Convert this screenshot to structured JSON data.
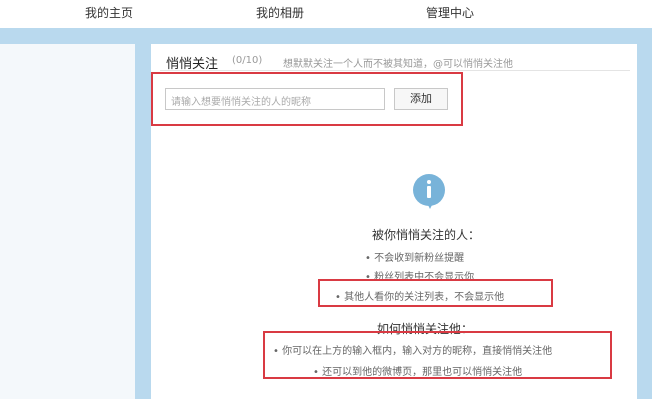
{
  "nav": {
    "items": [
      "我的主页",
      "我的相册",
      "管理中心"
    ]
  },
  "section": {
    "title": "悄悄关注",
    "count": "(0/10)",
    "hint": "想默默关注一个人而不被其知道，@可以悄悄关注他"
  },
  "form": {
    "input_placeholder": "请输入想要悄悄关注的人的昵称",
    "add_button": "添加"
  },
  "info_block": {
    "heading1": "被你悄悄关注的人：",
    "items1": [
      "不会收到新粉丝提醒",
      "粉丝列表中不会显示你",
      "其他人看你的关注列表，不会显示他"
    ],
    "heading2": "如何悄悄关注他：",
    "items2": [
      "你可以在上方的输入框内，输入对方的昵称，直接悄悄关注他",
      "还可以到他的微博页，那里也可以悄悄关注他"
    ]
  }
}
